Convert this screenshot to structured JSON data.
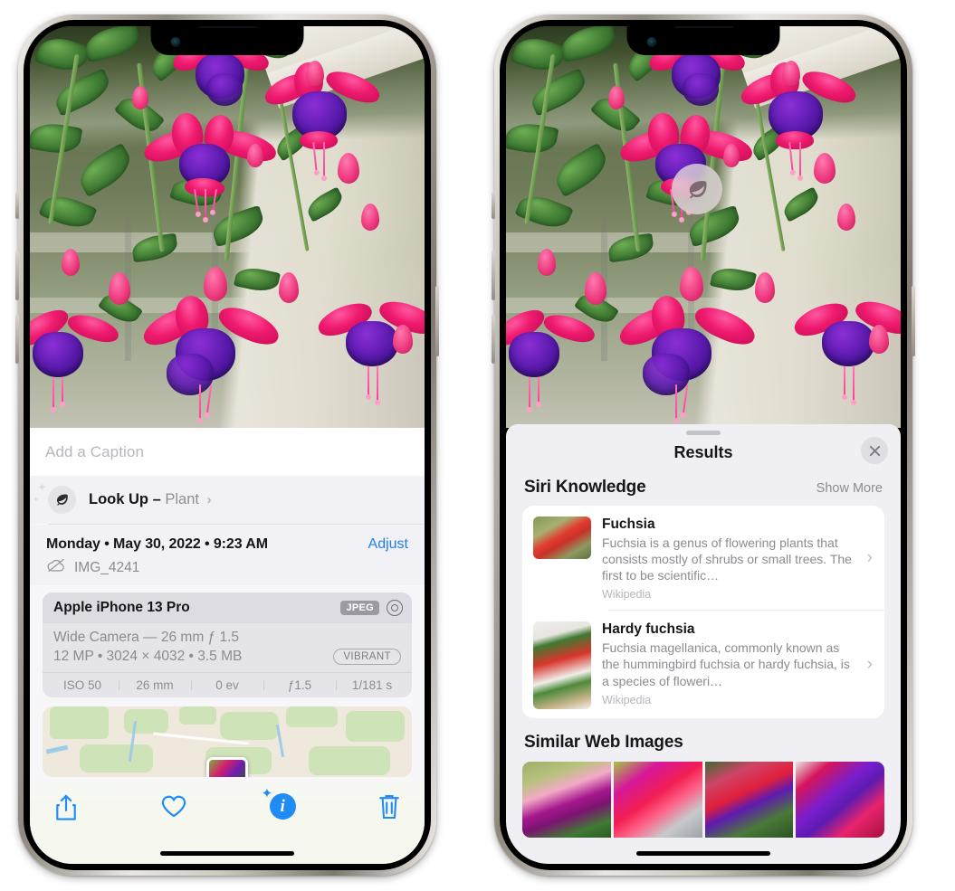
{
  "left_phone": {
    "name": "iphone-photos-info",
    "caption_placeholder": "Add a Caption",
    "lookup": {
      "label": "Look Up",
      "dash": "–",
      "subject": "Plant",
      "chevron": "›",
      "icon": "leaf-icon"
    },
    "metadata": {
      "date": "Monday • May 30, 2022 • 9:23 AM",
      "adjust_label": "Adjust",
      "filename": "IMG_4241",
      "cloud_icon": "icloud-slash-icon"
    },
    "exif": {
      "device": "Apple iPhone 13 Pro",
      "format_tag": "JPEG",
      "raw_icon": "raw-aperture-icon",
      "lens_line": "Wide Camera — 26 mm ƒ 1.5",
      "size_line": "12 MP • 3024 × 4032 • 3.5 MB",
      "style_pill": "VIBRANT",
      "stats": [
        "ISO 50",
        "26 mm",
        "0 ev",
        "ƒ1.5",
        "1/181 s"
      ]
    },
    "toolbar": [
      {
        "name": "share-button",
        "icon": "share-icon"
      },
      {
        "name": "favorite-button",
        "icon": "heart-icon"
      },
      {
        "name": "info-button",
        "icon": "info-sparkle-icon"
      },
      {
        "name": "delete-button",
        "icon": "trash-icon"
      }
    ]
  },
  "right_phone": {
    "name": "iphone-visual-lookup-results",
    "vlu_badge": {
      "icon": "leaf-icon",
      "name": "visual-look-up-badge"
    },
    "sheet": {
      "title": "Results",
      "close_icon": "close-icon",
      "sections": [
        {
          "title": "Siri Knowledge",
          "action": "Show More",
          "items": [
            {
              "title": "Fuchsia",
              "desc": "Fuchsia is a genus of flowering plants that consists mostly of shrubs or small trees. The first to be scientific…",
              "source": "Wikipedia",
              "chevron": "›"
            },
            {
              "title": "Hardy fuchsia",
              "desc": "Fuchsia magellanica, commonly known as the hummingbird fuchsia or hardy fuchsia, is a species of floweri…",
              "source": "Wikipedia",
              "chevron": "›"
            }
          ]
        },
        {
          "title": "Similar Web Images",
          "images": [
            "fuchsia-pink-white-bloom",
            "fuchsia-red-closeup",
            "fuchsia-shrub-buds",
            "fuchsia-purple-red-cluster"
          ]
        }
      ]
    }
  },
  "colors": {
    "accent_blue": "#1f8cf5",
    "sheet_bg": "#f0f0f4",
    "card_bg": "#ffffff",
    "secondary_text": "#8b8b92"
  }
}
